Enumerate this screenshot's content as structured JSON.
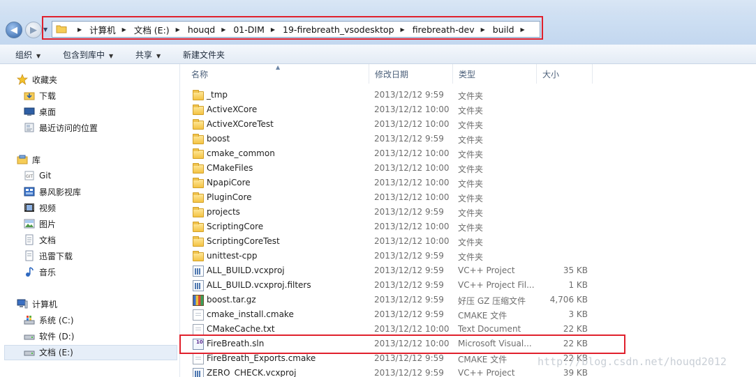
{
  "address": {
    "crumbs": [
      "计算机",
      "文档 (E:)",
      "houqd",
      "01-DIM",
      "19-firebreath_vsodesktop",
      "firebreath-dev",
      "build"
    ]
  },
  "toolbar": {
    "organize": "组织",
    "include_in_library": "包含到库中",
    "share": "共享",
    "new_folder": "新建文件夹"
  },
  "nav": {
    "favorites": "收藏夹",
    "downloads": "下载",
    "desktop": "桌面",
    "recent": "最近访问的位置",
    "libraries": "库",
    "git": "Git",
    "storm": "暴风影视库",
    "videos": "视频",
    "pictures": "图片",
    "documents": "文档",
    "xunlei": "迅雷下载",
    "music": "音乐",
    "computer": "计算机",
    "drive_c": "系统 (C:)",
    "drive_d": "软件 (D:)",
    "drive_e": "文档 (E:)"
  },
  "columns": {
    "name": "名称",
    "date": "修改日期",
    "type": "类型",
    "size": "大小"
  },
  "files": [
    {
      "name": "_tmp",
      "date": "2013/12/12 9:59",
      "type": "文件夹",
      "size": "",
      "icon": "folder-icon"
    },
    {
      "name": "ActiveXCore",
      "date": "2013/12/12 10:00",
      "type": "文件夹",
      "size": "",
      "icon": "folder-icon"
    },
    {
      "name": "ActiveXCoreTest",
      "date": "2013/12/12 10:00",
      "type": "文件夹",
      "size": "",
      "icon": "folder-icon"
    },
    {
      "name": "boost",
      "date": "2013/12/12 9:59",
      "type": "文件夹",
      "size": "",
      "icon": "folder-icon"
    },
    {
      "name": "cmake_common",
      "date": "2013/12/12 10:00",
      "type": "文件夹",
      "size": "",
      "icon": "folder-icon"
    },
    {
      "name": "CMakeFiles",
      "date": "2013/12/12 10:00",
      "type": "文件夹",
      "size": "",
      "icon": "folder-icon"
    },
    {
      "name": "NpapiCore",
      "date": "2013/12/12 10:00",
      "type": "文件夹",
      "size": "",
      "icon": "folder-icon"
    },
    {
      "name": "PluginCore",
      "date": "2013/12/12 10:00",
      "type": "文件夹",
      "size": "",
      "icon": "folder-icon"
    },
    {
      "name": "projects",
      "date": "2013/12/12 9:59",
      "type": "文件夹",
      "size": "",
      "icon": "folder-icon"
    },
    {
      "name": "ScriptingCore",
      "date": "2013/12/12 10:00",
      "type": "文件夹",
      "size": "",
      "icon": "folder-icon"
    },
    {
      "name": "ScriptingCoreTest",
      "date": "2013/12/12 10:00",
      "type": "文件夹",
      "size": "",
      "icon": "folder-icon"
    },
    {
      "name": "unittest-cpp",
      "date": "2013/12/12 9:59",
      "type": "文件夹",
      "size": "",
      "icon": "folder-icon"
    },
    {
      "name": "ALL_BUILD.vcxproj",
      "date": "2013/12/12 9:59",
      "type": "VC++ Project",
      "size": "35 KB",
      "icon": "vcxproj-icon"
    },
    {
      "name": "ALL_BUILD.vcxproj.filters",
      "date": "2013/12/12 9:59",
      "type": "VC++ Project Fil...",
      "size": "1 KB",
      "icon": "vcxproj-icon"
    },
    {
      "name": "boost.tar.gz",
      "date": "2013/12/12 9:59",
      "type": "好压 GZ 压缩文件",
      "size": "4,706 KB",
      "icon": "archive-icon"
    },
    {
      "name": "cmake_install.cmake",
      "date": "2013/12/12 9:59",
      "type": "CMAKE 文件",
      "size": "3 KB",
      "icon": "document-icon"
    },
    {
      "name": "CMakeCache.txt",
      "date": "2013/12/12 10:00",
      "type": "Text Document",
      "size": "22 KB",
      "icon": "document-icon"
    },
    {
      "name": "FireBreath.sln",
      "date": "2013/12/12 10:00",
      "type": "Microsoft Visual...",
      "size": "22 KB",
      "icon": "sln-icon"
    },
    {
      "name": "FireBreath_Exports.cmake",
      "date": "2013/12/12 9:59",
      "type": "CMAKE 文件",
      "size": "22 KB",
      "icon": "document-icon"
    },
    {
      "name": "ZERO_CHECK.vcxproj",
      "date": "2013/12/12 9:59",
      "type": "VC++ Project",
      "size": "39 KB",
      "icon": "vcxproj-icon"
    }
  ],
  "watermark": "http://blog.csdn.net/houqd2012",
  "colors": {
    "highlight_box": "#e0202c",
    "chrome": "#cfe0f3",
    "selection": "#e6eef8"
  }
}
